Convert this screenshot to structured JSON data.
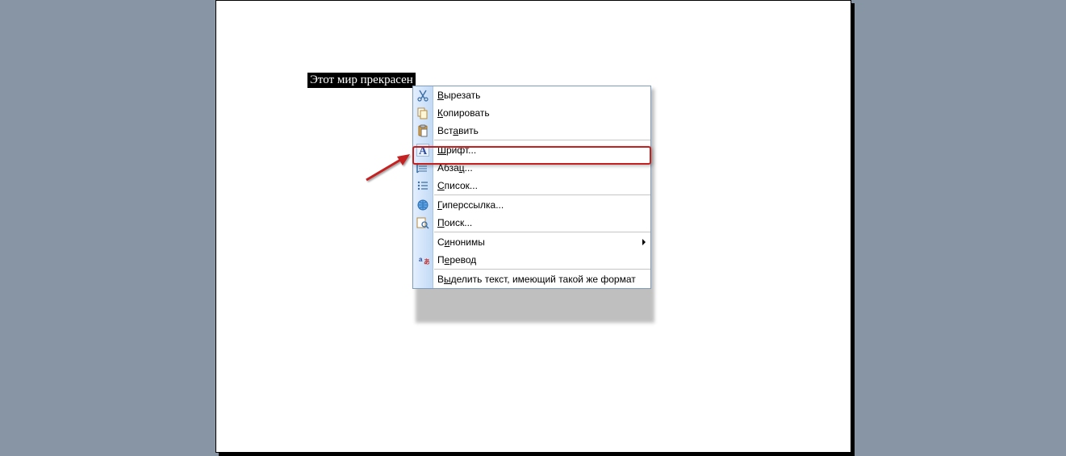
{
  "selection_text": "Этот мир прекрасен",
  "context_menu": {
    "cut": "Вырезать",
    "copy": "Копировать",
    "paste": "Вставить",
    "font": "Шрифт...",
    "paragraph": "Абзац...",
    "list": "Список...",
    "hyperlink": "Гиперссылка...",
    "find": "Поиск...",
    "synonyms": "Синонимы",
    "translate": "Перевод",
    "select_similar": "Выделить текст, имеющий такой же формат"
  }
}
